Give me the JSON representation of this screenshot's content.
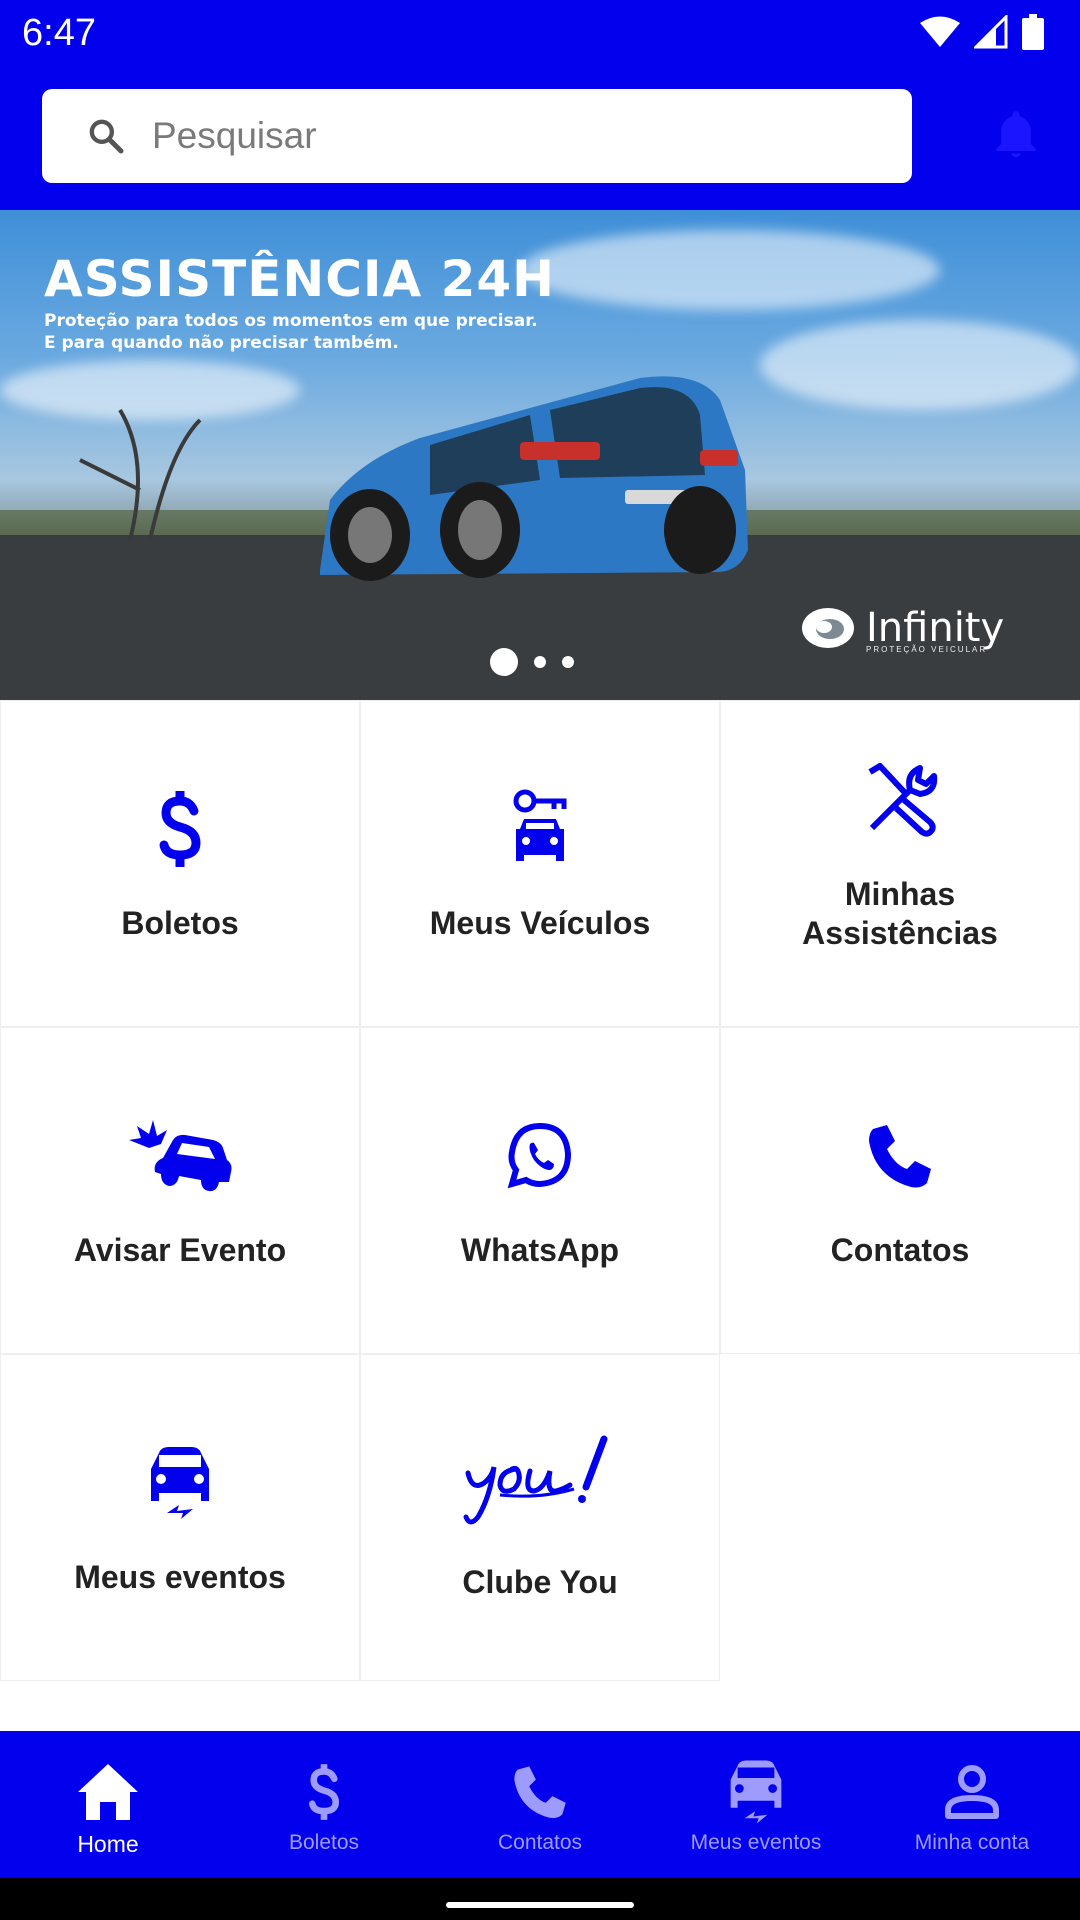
{
  "status_bar": {
    "time": "6:47"
  },
  "search": {
    "placeholder": "Pesquisar"
  },
  "banner": {
    "title": "ASSISTÊNCIA 24H",
    "subtitle_line1": "Proteção para todos os momentos em que precisar.",
    "subtitle_line2": "E para quando não precisar também.",
    "brand_name": "Infinity",
    "brand_tagline": "PROTEÇÃO VEICULAR",
    "active_slide": 1,
    "slide_count": 3
  },
  "tiles": [
    {
      "label": "Boletos",
      "icon": "dollar-icon"
    },
    {
      "label": "Meus Veículos",
      "icon": "car-key-icon"
    },
    {
      "label": "Minhas Assistências",
      "icon": "tools-icon"
    },
    {
      "label": "Avisar Evento",
      "icon": "car-crash-icon"
    },
    {
      "label": "WhatsApp",
      "icon": "whatsapp-icon"
    },
    {
      "label": "Contatos",
      "icon": "phone-icon"
    },
    {
      "label": "Meus eventos",
      "icon": "car-event-icon"
    },
    {
      "label": "Clube You",
      "icon": "you-logo-icon"
    }
  ],
  "bottom_nav": [
    {
      "label": "Home",
      "icon": "home-icon",
      "active": true
    },
    {
      "label": "Boletos",
      "icon": "dollar-icon",
      "active": false
    },
    {
      "label": "Contatos",
      "icon": "phone-icon",
      "active": false
    },
    {
      "label": "Meus eventos",
      "icon": "car-event-icon",
      "active": false
    },
    {
      "label": "Minha conta",
      "icon": "person-icon",
      "active": false
    }
  ],
  "colors": {
    "primary": "#0300ee",
    "nav_inactive": "#9e9bff",
    "tile_text": "#222222"
  }
}
